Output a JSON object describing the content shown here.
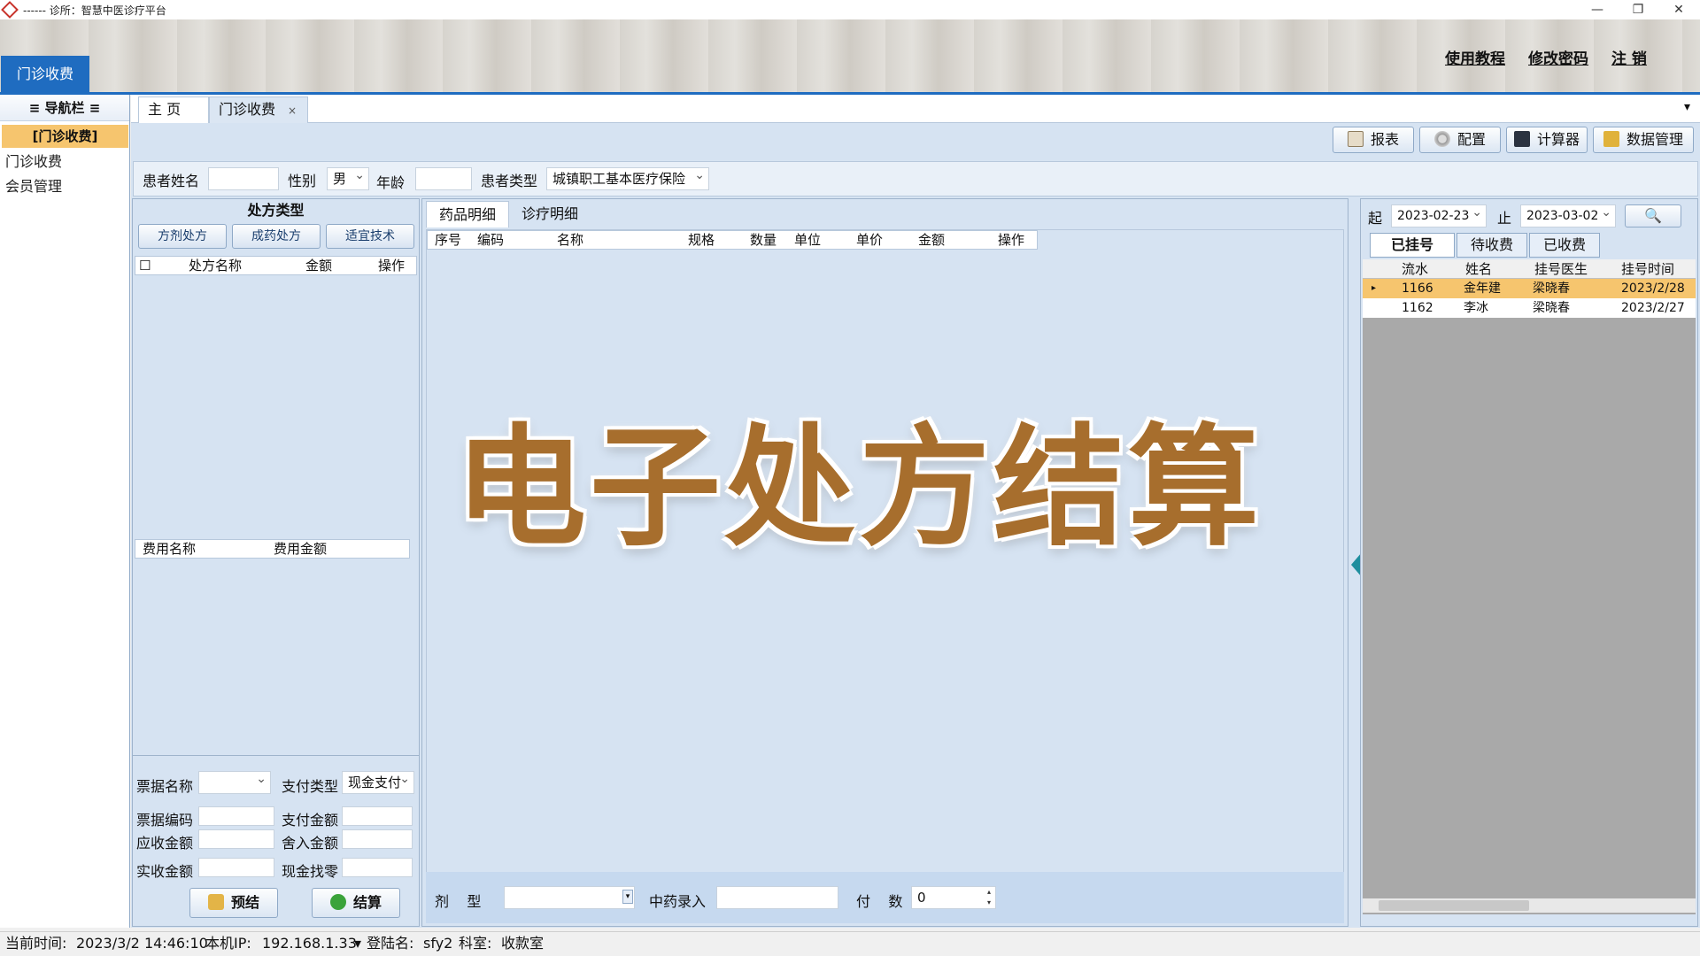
{
  "window": {
    "title": "------ 诊所：智慧中医诊疗平台",
    "minimize": "—",
    "restore": "❐",
    "close": "✕"
  },
  "header": {
    "links": [
      "使用教程",
      "修改密码",
      "注  销"
    ],
    "module_tab": "门诊收费"
  },
  "nav": {
    "title": "≡ 导航栏 ≡",
    "group": "[门诊收费]",
    "items": [
      "门诊收费",
      "会员管理"
    ]
  },
  "doc_tabs": {
    "home": "主  页",
    "current": "门诊收费",
    "close": "×",
    "overflow": "▾"
  },
  "toolbar": {
    "report": "报表",
    "config": "配置",
    "calculator": "计算器",
    "data_mgmt": "数据管理"
  },
  "patient": {
    "name_label": "患者姓名",
    "name_value": "",
    "gender_label": "性别",
    "gender_value": "男",
    "age_label": "年龄",
    "age_value": "",
    "type_label": "患者类型",
    "type_value": "城镇职工基本医疗保险"
  },
  "rx": {
    "title": "处方类型",
    "buttons": [
      "方剂处方",
      "成药处方",
      "适宜技术"
    ],
    "columns": [
      "☐",
      "处方名称",
      "金额",
      "操作"
    ],
    "fee_columns": [
      "费用名称",
      "费用金额"
    ],
    "form": {
      "invoice_name_label": "票据名称",
      "invoice_name_value": "",
      "pay_type_label": "支付类型",
      "pay_type_value": "现金支付",
      "invoice_code_label": "票据编码",
      "invoice_code_value": "",
      "pay_amount_label": "支付金额",
      "pay_amount_value": "",
      "receivable_label": "应收金额",
      "receivable_value": "",
      "rounding_label": "舍入金额",
      "rounding_value": "",
      "received_label": "实收金额",
      "received_value": "",
      "change_label": "现金找零",
      "change_value": ""
    },
    "pre_settle": "预结",
    "settle": "结算"
  },
  "center": {
    "tabs": [
      "药品明细",
      "诊疗明细"
    ],
    "columns": [
      "序号",
      "编码",
      "名称",
      "规格",
      "数量",
      "单位",
      "单价",
      "金额",
      "操作"
    ],
    "form_label": "剂    型",
    "form_value": "",
    "herb_input_label": "中药录入",
    "herb_input_value": "",
    "doses_label": "付    数",
    "doses_value": "0"
  },
  "right": {
    "from_label": "起",
    "from_date": "2023-02-23",
    "to_label": "止",
    "to_date": "2023-03-02",
    "tabs": [
      "已挂号",
      "待收费",
      "已收费"
    ],
    "columns": [
      "流水",
      "姓名",
      "挂号医生",
      "挂号时间"
    ],
    "rows": [
      {
        "id": "1166",
        "name": "金年建",
        "doctor": "梁晓春",
        "time": "2023/2/28",
        "selected": true
      },
      {
        "id": "1162",
        "name": "李冰",
        "doctor": "梁晓春",
        "time": "2023/2/27",
        "selected": false
      }
    ]
  },
  "overlay": "电子处方结算",
  "status": {
    "time_label": "当前时间:",
    "time_value": "2023/3/2 14:46:10",
    "ip_label": "本机IP:",
    "ip_value": "192.168.1.33",
    "user_label": "登陆名:",
    "user_value": "sfy2",
    "dept_label": "科室:",
    "dept_value": "收款室"
  },
  "colors": {
    "accent": "#1f6cc0",
    "nav_group": "#f6c56e",
    "selected_row": "#f6c56e",
    "overlay_text": "#a76e2d"
  }
}
